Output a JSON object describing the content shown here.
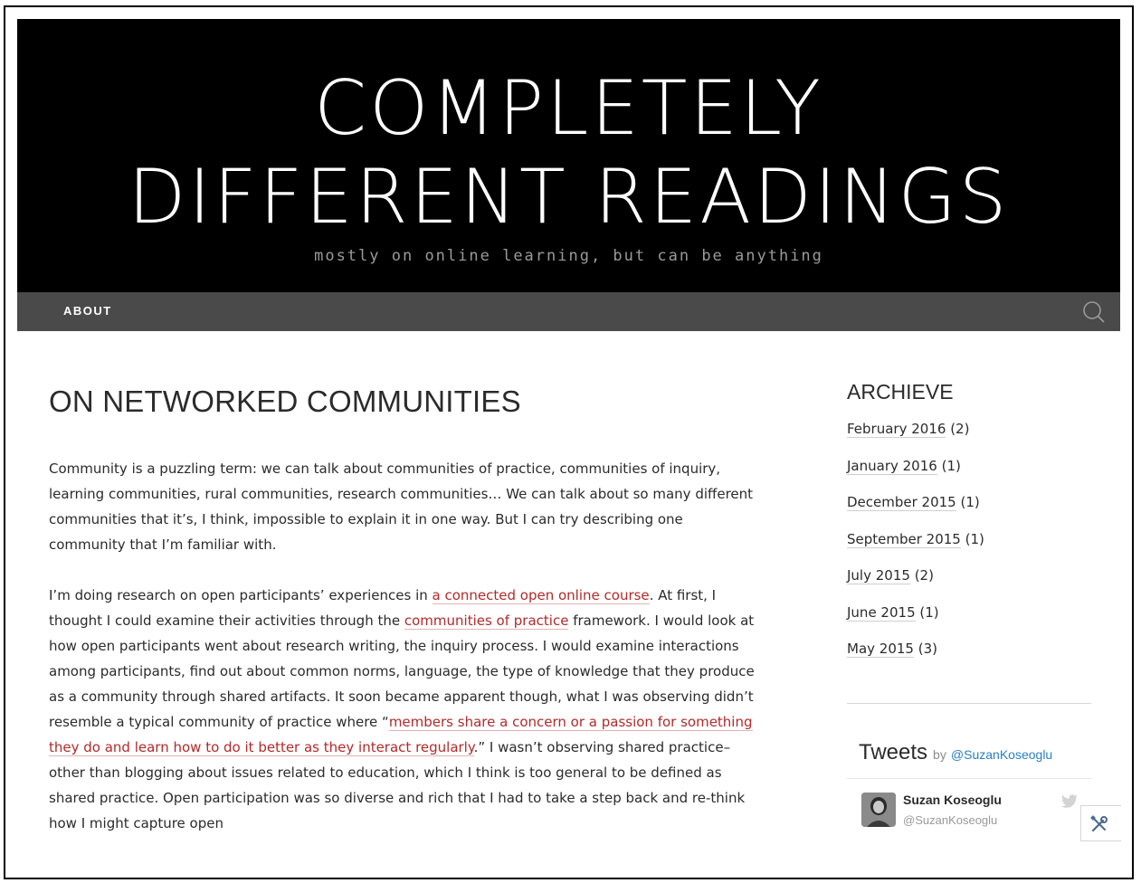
{
  "header": {
    "title_line1": "COMPLETELY",
    "title_line2": "DIFFERENT READINGS",
    "tagline": "mostly on online learning, but can be anything"
  },
  "nav": {
    "about_label": "ABOUT",
    "search_icon": "search-icon"
  },
  "post": {
    "title": "ON NETWORKED COMMUNITIES",
    "p1": "Community is a puzzling term: we can talk about communities of practice, communities of inquiry, learning communities, rural communities, research communities… We can talk about so many different communities that it’s, I think, impossible to explain it in one way. But I can try describing one community that I’m familiar with.",
    "p2": {
      "t1": "I’m doing research on open participants’ experiences in ",
      "link1": "a connected open online course",
      "t2": ". At first, I thought I could examine their activities through the ",
      "link2": "communities of practice",
      "t3": " framework. I would look at how open participants went about research writing, the inquiry process. I would examine interactions among participants, find out about common norms, language, the type of knowledge that they produce as a community through shared artifacts. It soon became apparent though, what I was observing didn’t resemble a typical community of practice where “",
      "link3": "members share a concern or a passion for something they do and learn how to do it better as they interact regularly",
      "t4": ".” I wasn’t observing shared practice–other than blogging about issues related to education, which I think is too general to be defined as shared practice. Open participation was so diverse and rich that I had to take a step back and re-think how I might capture open"
    },
    "link_color": "#b12a2a"
  },
  "sidebar": {
    "archive_title": "ARCHIEVE",
    "archive_items": [
      {
        "month": "February 2016",
        "count": "(2)"
      },
      {
        "month": "January 2016",
        "count": "(1)"
      },
      {
        "month": "December 2015",
        "count": "(1)"
      },
      {
        "month": "September 2015",
        "count": "(1)"
      },
      {
        "month": "July 2015",
        "count": "(2)"
      },
      {
        "month": "June 2015",
        "count": "(1)"
      },
      {
        "month": "May 2015",
        "count": "(3)"
      }
    ],
    "tweets": {
      "title": "Tweets",
      "by": "by",
      "handle": "@SuzanKoseoglu",
      "author": "Suzan Koseoglu",
      "author_handle": "@SuzanKoseoglu",
      "bird_icon": "twitter-bird-icon",
      "twitter_color": "#2a7fc2"
    }
  },
  "tools_icon": "wrench-icon"
}
